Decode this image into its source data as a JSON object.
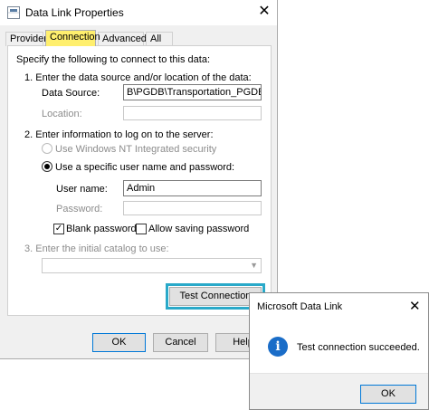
{
  "dialog": {
    "title": "Data Link Properties",
    "tabs": [
      "Provider",
      "Connection",
      "Advanced",
      "All"
    ],
    "active_tab": "Connection",
    "intro": "Specify the following to connect to this data:",
    "step1": "1. Enter the data source and/or location of the data:",
    "data_source_label": "Data Source:",
    "data_source_value": "B\\PGDB\\Transportation_PGDB.mdb",
    "location_label": "Location:",
    "step2": "2. Enter information to log on to the server:",
    "nt_security_label": "Use Windows NT Integrated security",
    "specific_user_label": "Use a specific user name and password:",
    "username_label": "User name:",
    "username_value": "Admin",
    "password_label": "Password:",
    "blank_password_label": "Blank password",
    "allow_saving_label": "Allow saving password",
    "step3": "3. Enter the initial catalog to use:",
    "test_connection_label": "Test Connection",
    "ok_label": "OK",
    "cancel_label": "Cancel",
    "help_label": "Help"
  },
  "message_box": {
    "title": "Microsoft Data Link",
    "message": "Test connection succeeded.",
    "ok_label": "OK"
  },
  "colors": {
    "active_tab_highlight": "#ffef6e",
    "test_button_highlight": "#29a9c9",
    "info_icon": "#1a6dc8"
  }
}
